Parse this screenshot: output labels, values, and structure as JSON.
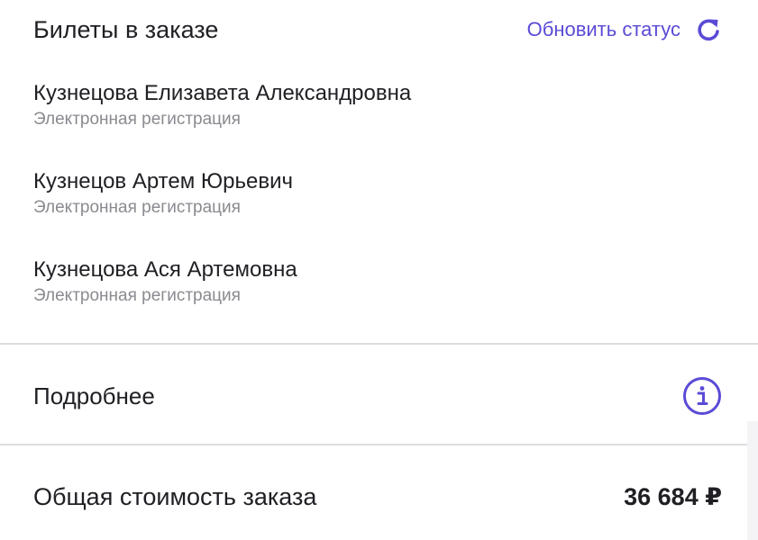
{
  "tickets_section": {
    "title": "Билеты в заказе",
    "refresh_label": "Обновить статус",
    "refresh_icon": "refresh-icon",
    "accent_color": "#5a4bd6"
  },
  "tickets": [
    {
      "name": "Кузнецова Елизавета Александровна",
      "status": "Электронная регистрация"
    },
    {
      "name": "Кузнецов Артем Юрьевич",
      "status": "Электронная регистрация"
    },
    {
      "name": "Кузнецова Ася Артемовна",
      "status": "Электронная регистрация"
    }
  ],
  "details": {
    "label": "Подробнее",
    "icon": "info-icon"
  },
  "total": {
    "label": "Общая стоимость заказа",
    "value": "36 684 ₽"
  }
}
